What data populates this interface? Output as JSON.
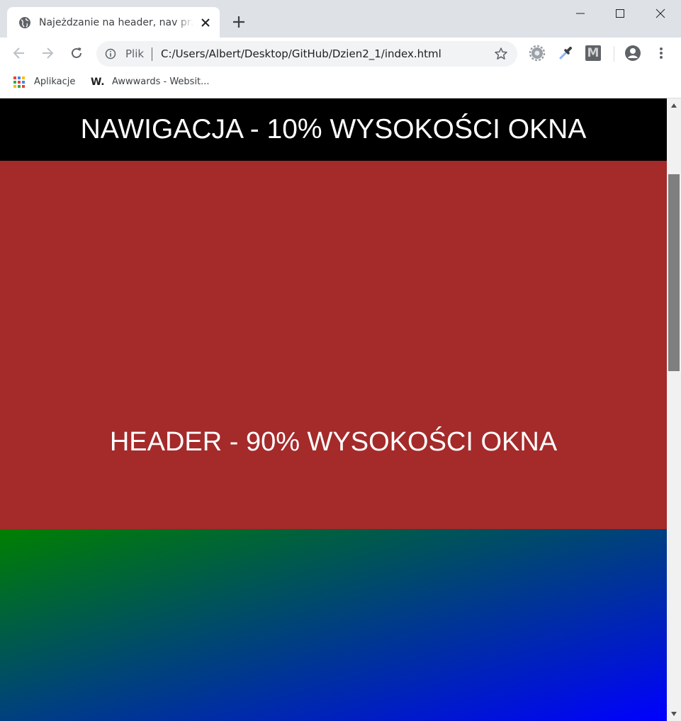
{
  "browser": {
    "tab": {
      "title": "Najeżdzanie na header, nav przyp"
    },
    "address_bar": {
      "chip_label": "Plik",
      "url": "C:/Users/Albert/Desktop/GitHub/Dzien2_1/index.html"
    },
    "bookmarks": [
      {
        "label": "Aplikacje",
        "icon": "apps-grid-icon"
      },
      {
        "label": "Awwwards - Websit...",
        "icon": "awwwards-w-icon",
        "icon_text": "W."
      }
    ],
    "extensions": [
      {
        "name": "gear-extension-icon"
      },
      {
        "name": "eyedropper-extension-icon"
      },
      {
        "name": "m-extension-icon",
        "icon_text": "M"
      }
    ]
  },
  "page": {
    "nav": {
      "text": "NAWIGACJA - 10% WYSOKOŚCI OKNA",
      "background": "#000000"
    },
    "header": {
      "text": "HEADER - 90% WYSOKOŚCI OKNA",
      "background": "#a52a2a"
    },
    "section": {
      "gradient_start": "#008000",
      "gradient_end": "#0000ff"
    }
  },
  "colors": {
    "text_on_page": "#ffffff",
    "chrome_titlebar": "#dee1e6",
    "omnibox": "#f1f3f4"
  }
}
